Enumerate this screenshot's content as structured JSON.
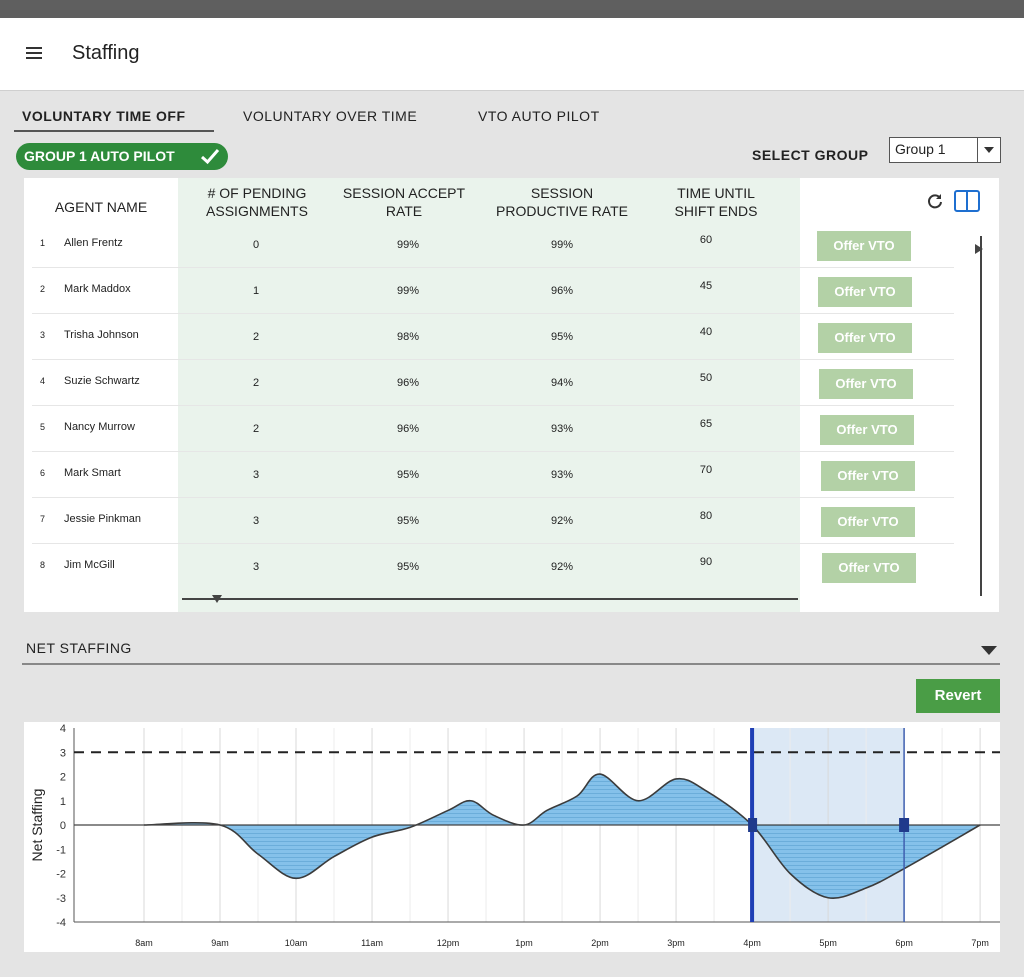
{
  "header": {
    "title": "Staffing"
  },
  "tabs": [
    {
      "label": "VOLUNTARY TIME OFF",
      "active": true
    },
    {
      "label": "VOLUNTARY OVER TIME",
      "active": false
    },
    {
      "label": "VTO AUTO PILOT",
      "active": false
    }
  ],
  "autopilot": {
    "label": "GROUP 1 AUTO PILOT",
    "icon": "check-icon",
    "color": "#2e8b3b"
  },
  "group_select": {
    "label": "SELECT GROUP",
    "value": "Group 1"
  },
  "table": {
    "headers": {
      "agent": "AGENT NAME",
      "pending": [
        "# OF PENDING",
        "ASSIGNMENTS"
      ],
      "accept": [
        "SESSION ACCEPT",
        "RATE"
      ],
      "productive": [
        "SESSION",
        "PRODUCTIVE RATE"
      ],
      "time": [
        "TIME UNTIL",
        "SHIFT ENDS"
      ]
    },
    "toolbar_icons": [
      "refresh-icon",
      "columns-icon"
    ],
    "action_label": "Offer VTO",
    "rows": [
      {
        "num": "1",
        "name": "Allen Frentz",
        "pending": "0",
        "accept": "99%",
        "productive": "99%",
        "time": "60"
      },
      {
        "num": "2",
        "name": "Mark Maddox",
        "pending": "1",
        "accept": "99%",
        "productive": "96%",
        "time": "45"
      },
      {
        "num": "3",
        "name": "Trisha Johnson",
        "pending": "2",
        "accept": "98%",
        "productive": "95%",
        "time": "40"
      },
      {
        "num": "4",
        "name": "Suzie Schwartz",
        "pending": "2",
        "accept": "96%",
        "productive": "94%",
        "time": "50"
      },
      {
        "num": "5",
        "name": "Nancy Murrow",
        "pending": "2",
        "accept": "96%",
        "productive": "93%",
        "time": "65"
      },
      {
        "num": "6",
        "name": "Mark Smart",
        "pending": "3",
        "accept": "95%",
        "productive": "93%",
        "time": "70"
      },
      {
        "num": "7",
        "name": "Jessie Pinkman",
        "pending": "3",
        "accept": "95%",
        "productive": "92%",
        "time": "80"
      },
      {
        "num": "8",
        "name": "Jim McGill",
        "pending": "3",
        "accept": "95%",
        "productive": "92%",
        "time": "90"
      }
    ]
  },
  "net_staffing": {
    "label": "NET STAFFING",
    "revert_label": "Revert"
  },
  "chart_data": {
    "type": "area",
    "ylabel": "Net Staffing",
    "ylim": [
      -4,
      4
    ],
    "yticks": [
      "4",
      "3",
      "2",
      "1",
      "0",
      "-1",
      "-2",
      "-3",
      "-4"
    ],
    "xticks": [
      "8am",
      "9am",
      "10am",
      "11am",
      "12pm",
      "1pm",
      "2pm",
      "3pm",
      "4pm",
      "5pm",
      "6pm",
      "7pm"
    ],
    "threshold": 3,
    "selection": [
      "4pm",
      "6pm"
    ],
    "colors": {
      "fill": "#85c1ea",
      "selection": "#dce8f5",
      "selection_edge": "#1f3fb5"
    },
    "series": [
      {
        "x": [
          8,
          9,
          9.5,
          10,
          10.5,
          11,
          11.5,
          12,
          12.3,
          12.6,
          13,
          13.3,
          13.7,
          14,
          14.5,
          15,
          15.4,
          16,
          16.5,
          17,
          17.5,
          18,
          19
        ],
        "y": [
          0,
          0,
          -1.2,
          -2.2,
          -1.3,
          -0.5,
          -0.1,
          0.6,
          1.0,
          0.4,
          0,
          0.6,
          1.2,
          2.1,
          1.0,
          1.9,
          1.4,
          0,
          -2.0,
          -3.0,
          -2.6,
          -1.8,
          0
        ]
      }
    ]
  }
}
